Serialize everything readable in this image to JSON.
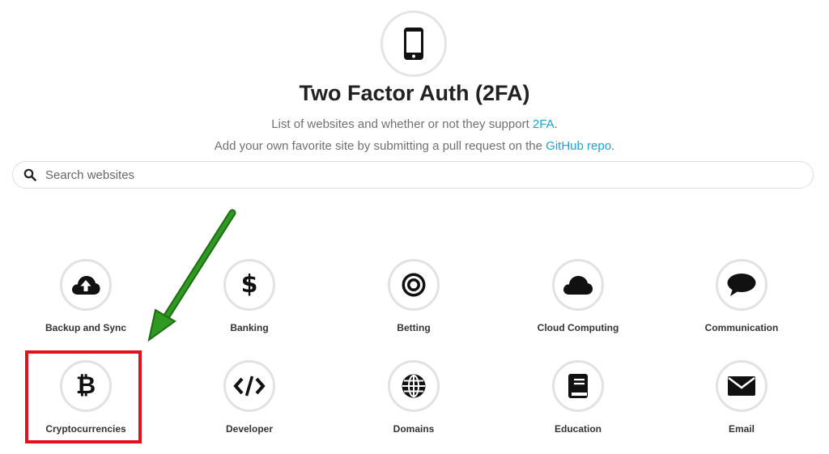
{
  "header": {
    "title": "Two Factor Auth (2FA)",
    "line1_text": "List of websites and whether or not they support ",
    "line1_link": "2FA",
    "line1_end": ".",
    "line2_text": "Add your own favorite site by submitting a pull request on the ",
    "line2_link": "GitHub repo",
    "line2_end": "."
  },
  "search": {
    "placeholder": "Search websites",
    "value": ""
  },
  "categories": [
    {
      "label": "Backup and Sync",
      "icon": "cloud-upload-icon"
    },
    {
      "label": "Banking",
      "icon": "dollar-icon"
    },
    {
      "label": "Betting",
      "icon": "target-icon"
    },
    {
      "label": "Cloud Computing",
      "icon": "cloud-icon"
    },
    {
      "label": "Communication",
      "icon": "speech-bubble-icon"
    },
    {
      "label": "Cryptocurrencies",
      "icon": "bitcoin-icon"
    },
    {
      "label": "Developer",
      "icon": "code-icon"
    },
    {
      "label": "Domains",
      "icon": "globe-icon"
    },
    {
      "label": "Education",
      "icon": "book-icon"
    },
    {
      "label": "Email",
      "icon": "envelope-icon"
    }
  ],
  "colors": {
    "link": "#1aa3d9",
    "highlight": "#e0121d",
    "arrow": "#2e8b22"
  }
}
